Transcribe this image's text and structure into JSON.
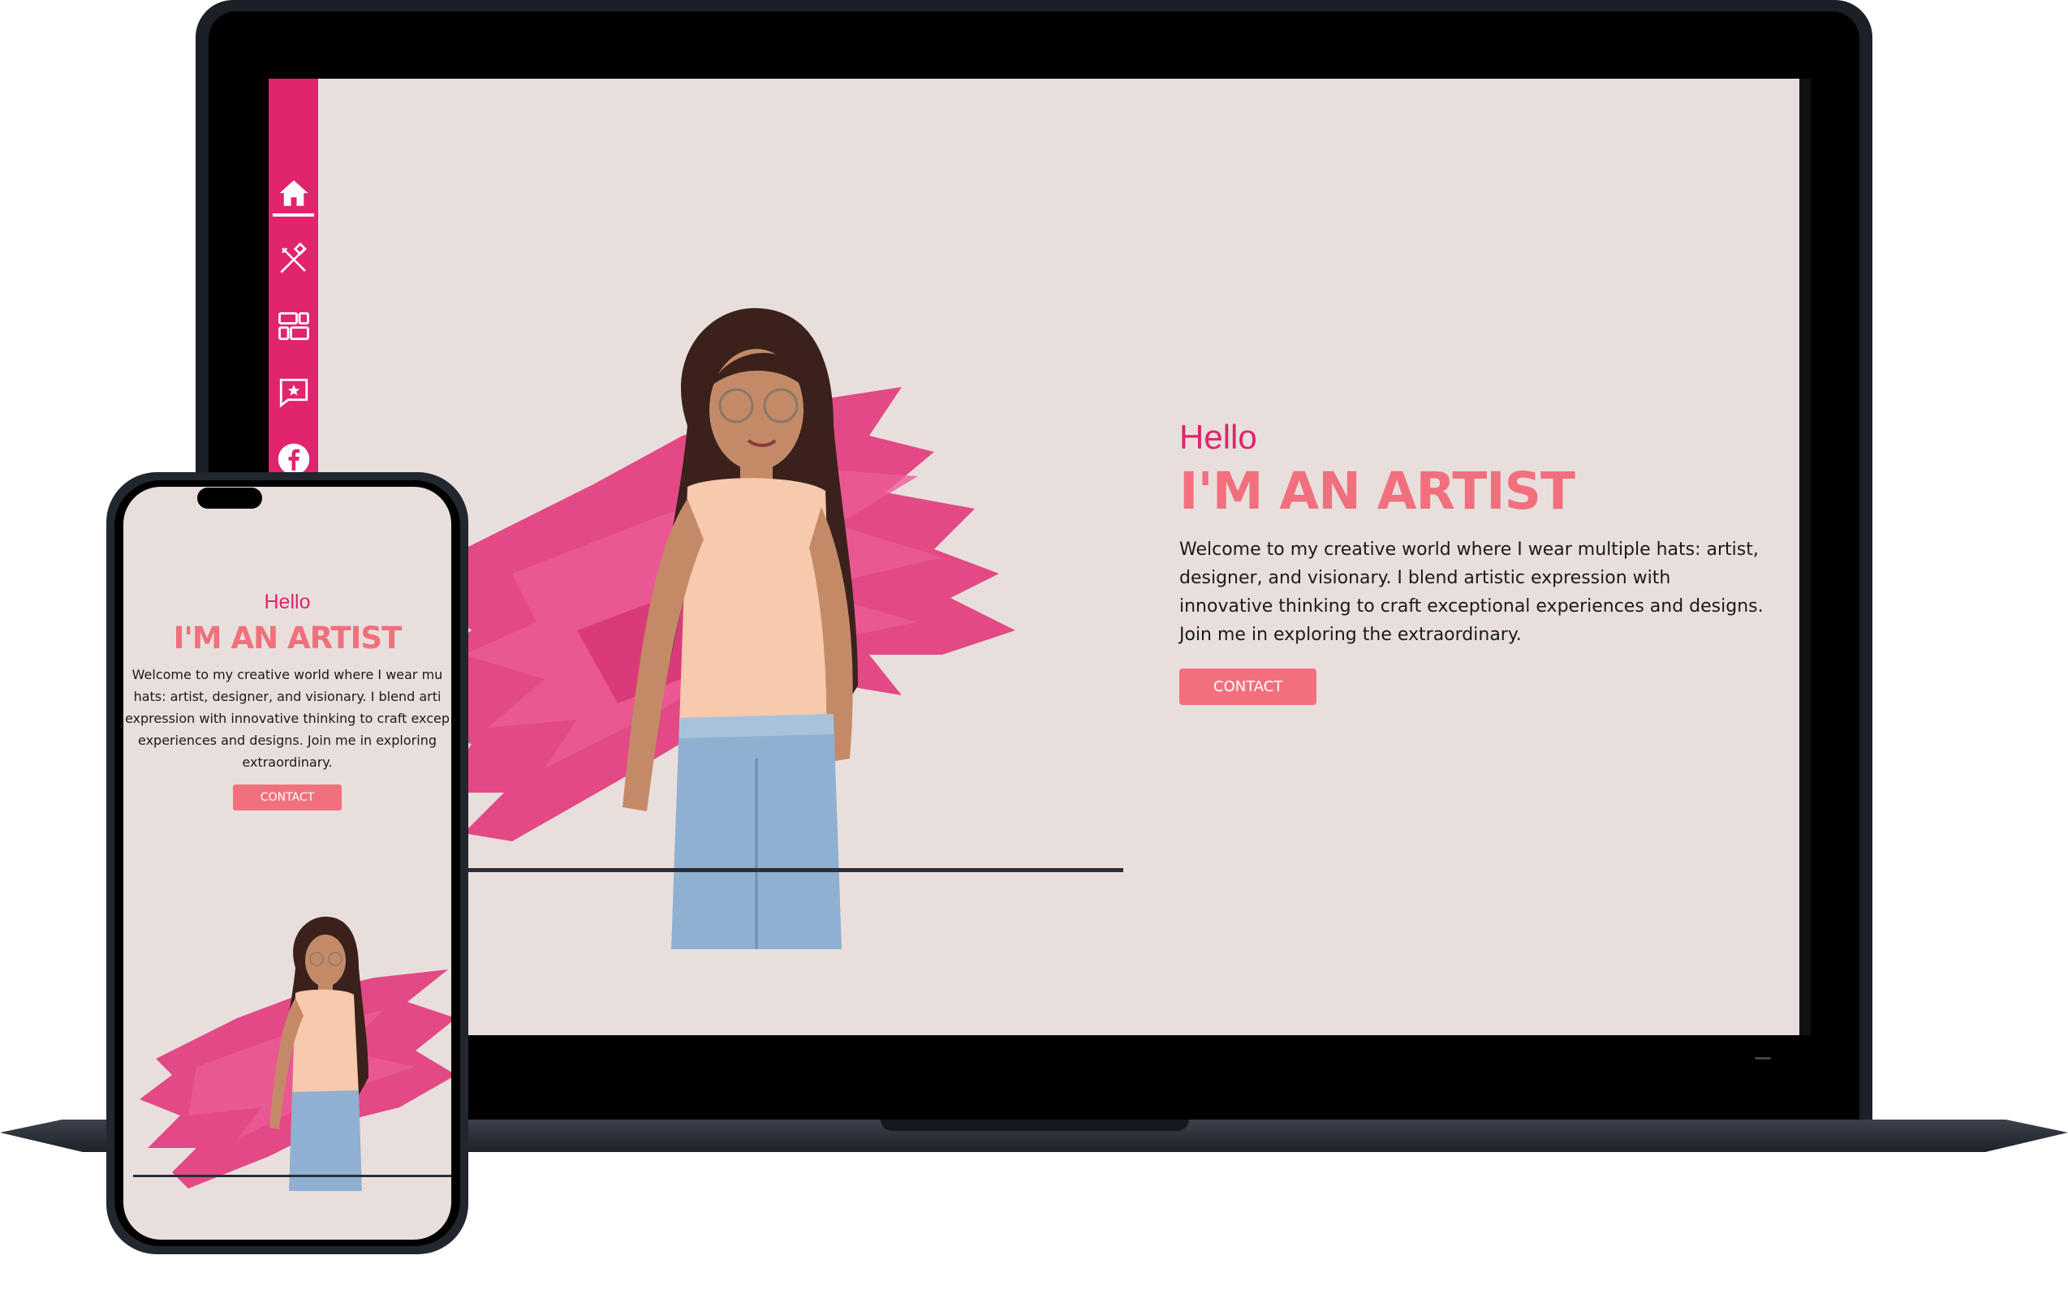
{
  "sidebar": {
    "items": [
      {
        "icon": "home-icon",
        "active": true
      },
      {
        "icon": "tools-icon",
        "active": false
      },
      {
        "icon": "grid-icon",
        "active": false
      },
      {
        "icon": "star-chat-icon",
        "active": false
      },
      {
        "icon": "facebook-icon",
        "active": false
      }
    ]
  },
  "hero": {
    "greeting": "Hello",
    "headline": "I'M AN ARTIST",
    "description": "Welcome to my creative world where I wear multiple hats: artist, designer, and visionary. I blend artistic expression with innovative thinking to craft exceptional experiences and designs. Join me in exploring the extraordinary.",
    "cta_label": "CONTACT"
  },
  "mobile": {
    "greeting": "Hello",
    "headline": "I'M AN ARTIST",
    "description": "Welcome to my creative world where I wear mu\nhats: artist, designer, and visionary. I blend arti\nexpression with innovative thinking to craft excep\nexperiences and designs. Join me in exploring\nextraordinary.",
    "cta_label": "CONTACT"
  },
  "colors": {
    "accent_pink": "#e0246e",
    "coral": "#f2707d",
    "background": "#e8dfdd"
  }
}
